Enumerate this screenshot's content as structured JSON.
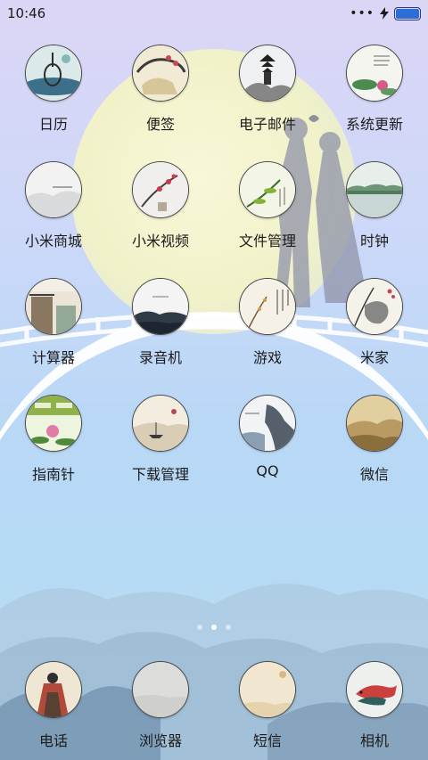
{
  "status_bar": {
    "time": "10:46",
    "signal": "•••",
    "charging_icon": "bolt-icon",
    "battery_level": 1.0,
    "battery_color": "#2c6ed6"
  },
  "apps": [
    {
      "label": "日历",
      "icon": "pipa-painting-icon"
    },
    {
      "label": "便签",
      "icon": "plum-blossom-rock-icon"
    },
    {
      "label": "电子邮件",
      "icon": "pagoda-ink-icon"
    },
    {
      "label": "系统更新",
      "icon": "lotus-poem-icon"
    },
    {
      "label": "小米商城",
      "icon": "misty-landscape-icon"
    },
    {
      "label": "小米视频",
      "icon": "red-plum-icon"
    },
    {
      "label": "文件管理",
      "icon": "green-branch-icon"
    },
    {
      "label": "时钟",
      "icon": "lake-shore-icon"
    },
    {
      "label": "计算器",
      "icon": "pavilion-icon"
    },
    {
      "label": "录音机",
      "icon": "foggy-mountain-icon"
    },
    {
      "label": "游戏",
      "icon": "flower-calligraphy-icon"
    },
    {
      "label": "米家",
      "icon": "orchid-rock-icon"
    },
    {
      "label": "指南针",
      "icon": "lotus-pond-icon"
    },
    {
      "label": "下载管理",
      "icon": "boat-landscape-icon"
    },
    {
      "label": "QQ",
      "icon": "cliff-lake-icon"
    },
    {
      "label": "微信",
      "icon": "sepia-landscape-icon"
    }
  ],
  "dock": [
    {
      "label": "电话",
      "icon": "figure-painting-icon"
    },
    {
      "label": "浏览器",
      "icon": "grey-texture-icon"
    },
    {
      "label": "短信",
      "icon": "parchment-icon"
    },
    {
      "label": "相机",
      "icon": "koi-fish-icon"
    }
  ],
  "page_indicator": {
    "count": 3,
    "active_index": 1
  }
}
